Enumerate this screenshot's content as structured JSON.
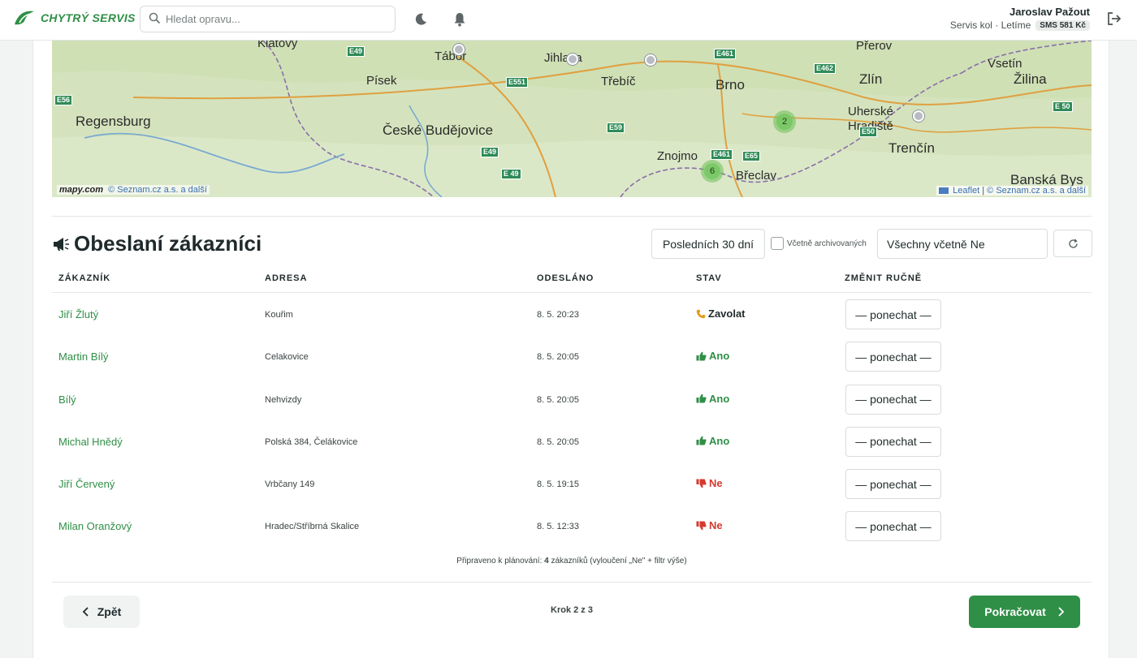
{
  "app": {
    "brand": "CHYTRÝ SERVIS",
    "search_placeholder": "Hledat opravu...",
    "user_name": "Jaroslav Pažout",
    "user_company": "Servis kol · Letíme",
    "sms_credit": "SMS 581 Kč"
  },
  "map": {
    "attribution_left": "© Seznam.cz a.s. a další",
    "attribution_left_logo": "mapy.com",
    "attribution_right_leaflet": "Leaflet",
    "attribution_right": "© Seznam.cz a.s. a další",
    "cities": [
      "Klatovy",
      "Tábor",
      "Jihlava",
      "Přerov",
      "Vsetín",
      "Zlín",
      "Žilina",
      "Písek",
      "Třebíč",
      "Brno",
      "Uherské Hradiště",
      "Regensburg",
      "České Budějovice",
      "Znojmo",
      "Břeclav",
      "Trenčín",
      "Banská Bys"
    ],
    "roads": [
      "E49",
      "E461",
      "E462",
      "E56",
      "E551",
      "E59",
      "E49",
      "E 49",
      "E461",
      "E65",
      "E50",
      "E 50"
    ],
    "clusters": [
      "2",
      "6"
    ]
  },
  "section": {
    "title": "Obeslaní zákazníci",
    "period_button": "Posledních 30 dní",
    "archived_label": "Včetně archivovaných",
    "filter_value": "Všechny včetně Ne"
  },
  "table": {
    "headers": [
      "Zákazník",
      "Adresa",
      "Odesláno",
      "Stav",
      "Změnit ručně"
    ],
    "keep_label": "— ponechat —",
    "rows": [
      {
        "name": "Jiří Žlutý",
        "address": "Kouřim",
        "sent": "8. 5. 20:23",
        "status": "Zavolat",
        "kind": "zavolat"
      },
      {
        "name": "Martin Bílý",
        "address": "Celakovice",
        "sent": "8. 5. 20:05",
        "status": "Ano",
        "kind": "ano"
      },
      {
        "name": "Bílý",
        "address": "Nehvizdy",
        "sent": "8. 5. 20:05",
        "status": "Ano",
        "kind": "ano"
      },
      {
        "name": "Michal Hnědý",
        "address": "Polská 384, Čelákovice",
        "sent": "8. 5. 20:05",
        "status": "Ano",
        "kind": "ano"
      },
      {
        "name": "Jiří Červený",
        "address": "Vrbčany 149",
        "sent": "8. 5. 19:15",
        "status": "Ne",
        "kind": "ne"
      },
      {
        "name": "Milan Oranžový",
        "address": "Hradec/Stříbrná Skalice",
        "sent": "8. 5. 12:33",
        "status": "Ne",
        "kind": "ne"
      }
    ]
  },
  "summary": {
    "prefix": "Připraveno k plánování:",
    "count": "4",
    "suffix": "zákazníků (vyloučení „Ne\" + filtr výše)"
  },
  "footer": {
    "back_label": "Zpět",
    "step_label": "Krok 2 z 3",
    "next_label": "Pokračovat"
  },
  "colors": {
    "brand_green": "#2f8f46",
    "status_ano": "#2f8f46",
    "status_ne": "#d63a2f",
    "status_zavolat": "#e39b1c"
  }
}
